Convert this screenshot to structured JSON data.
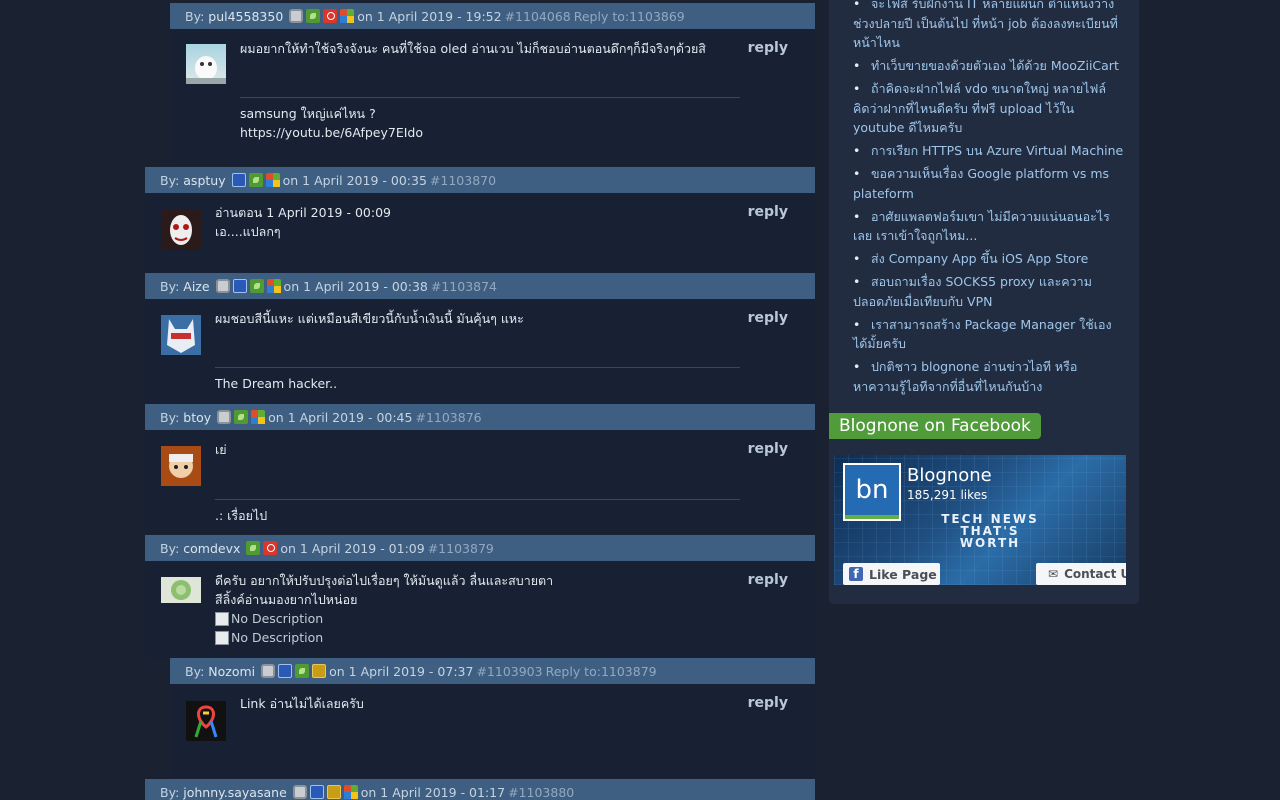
{
  "comments": [
    {
      "author": "pul4558350",
      "by": "By:",
      "date": "on 1 April 2019 - 19:52",
      "id": "#1104068",
      "reply_to": "Reply to:1103869",
      "body": "ผมอยากให้ทำใช้จริงจังนะ คนที่ใช้จอ oled อ่านเวบ ไม่ก็ชอบอ่านตอนดึกๆก็มีจริงๆด้วยสิ",
      "sig1": "samsung ใหญ่แค่ไหน ?",
      "sig2": "https://youtu.be/6Afpey7EIdo",
      "reply": "reply",
      "badges": [
        "gray",
        "green",
        "red",
        "windows"
      ]
    },
    {
      "author": "asptuy",
      "by": "By:",
      "date": "on 1 April 2019 - 00:35",
      "id": "#1103870",
      "body1": "อ่านตอน 1 April 2019 - 00:09",
      "body2": "เอ....แปลกๆ",
      "reply": "reply",
      "badges": [
        "blue",
        "green",
        "windows"
      ]
    },
    {
      "author": "Aize",
      "by": "By:",
      "date": "on 1 April 2019 - 00:38",
      "id": "#1103874",
      "body": "ผมชอบสีนี้แหะ แต่เหมือนสีเขียวนี้กับน้ำเงินนี้ มันคุ้นๆ แหะ",
      "sig1": "The Dream hacker..",
      "reply": "reply",
      "badges": [
        "gray",
        "blue",
        "green",
        "windows"
      ]
    },
    {
      "author": "btoy",
      "by": "By:",
      "date": "on 1 April 2019 - 00:45",
      "id": "#1103876",
      "body": "เย่",
      "sig1": ".: เรื่อยไป",
      "reply": "reply",
      "badges": [
        "gray",
        "green",
        "windows"
      ]
    },
    {
      "author": "comdevx",
      "by": "By:",
      "date": "on 1 April 2019 - 01:09",
      "id": "#1103879",
      "body1": "ดีครับ อยากให้ปรับปรุงต่อไปเรื่อยๆ ให้มันดูแล้ว ลื่นและสบายตา",
      "body2": "สีลิ้งค์อ่านมองยากไปหน่อย",
      "img_alt1": "No Description",
      "img_alt2": "No Description",
      "reply": "reply",
      "badges": [
        "green",
        "red"
      ]
    },
    {
      "author": "Nozomi",
      "by": "By:",
      "date": "on 1 April 2019 - 07:37",
      "id": "#1103903",
      "reply_to": "Reply to:1103879",
      "body": "Link อ่านไม่ได้เลยครับ",
      "reply": "reply",
      "badges": [
        "gray",
        "blue",
        "green",
        "gold"
      ]
    },
    {
      "author": "johnny.sayasane",
      "by": "By:",
      "date": "on 1 April 2019 - 01:17",
      "id": "#1103880",
      "badges": [
        "gray",
        "blue",
        "gold",
        "windows"
      ]
    }
  ],
  "sidebar": {
    "links": [
      "จะไฟส์ รับฝึกงาน IT หลายแผนก ตำแหน่งว่าง ช่วงปลายปี เป็นต้นไป ที่หน้า job ต้องลงทะเบียนที่หน้าไหน",
      "ทำเว็บขายของด้วยตัวเอง ได้ด้วย MooZiiCart",
      "ถ้าคิดจะฝากไฟล์ vdo ขนาดใหญ่ หลายไฟล์ คิดว่าฝากที่ไหนดีครับ ที่ฟรี upload ไว้ใน youtube ดีไหมครับ",
      "การเรียก HTTPS บน Azure Virtual Machine",
      "ขอความเห็นเรื่อง Google platform vs ms plateform",
      "อาศัยแพลตฟอร์มเขา ไม่มีความแน่นอนอะไรเลย เราเข้าใจถูกไหม...",
      "ส่ง Company App ขึ้น iOS App Store",
      "สอบถามเรื่อง SOCKS5 proxy และความปลอดภัยเมื่อเทียบกับ VPN",
      "เราสามารถสร้าง Package Manager ใช้เองได้มั้ยครับ",
      "ปกติชาว blognone อ่านข่าวไอที หรือ หาความรู้ไอทีจากที่อื่นที่ไหนกันบ้าง"
    ],
    "facebook_title": "Blognone on Facebook",
    "fb_logo": "bn",
    "fb_page_name": "Blognone",
    "fb_likes": "185,291 likes",
    "fb_tagline": "TECH NEWS THAT'S WORTH",
    "fb_like_button": "Like Page",
    "fb_contact_button": "Contact U"
  },
  "colors": {
    "background": "#1a2231",
    "header": "#3e5f82",
    "comment_bg": "#172133",
    "sidebar_bg": "#212c41",
    "link": "#9fc6ea",
    "fb_green": "#509c3b"
  }
}
